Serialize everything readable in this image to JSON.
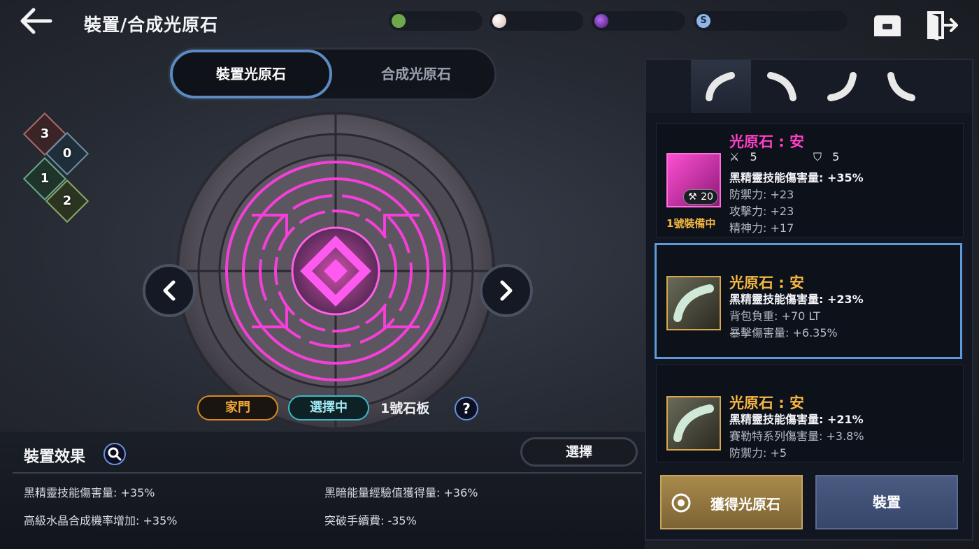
{
  "header": {
    "title": "裝置/合成光原石",
    "back_icon": "arrow-left-icon",
    "inventory_icon": "inventory-box-icon",
    "exit_icon": "exit-door-icon",
    "currencies": [
      {
        "icon": "green-crystal-icon",
        "color": "#6fa84a",
        "value": ""
      },
      {
        "icon": "pearl-icon",
        "color": "#e7c9c0",
        "value": ""
      },
      {
        "icon": "purple-orb-icon",
        "color": "#7a2fb8",
        "value": ""
      },
      {
        "icon": "silver-coin-icon",
        "color": "#8fb6e6",
        "value": ""
      }
    ]
  },
  "mode_tabs": {
    "equip": "裝置光原石",
    "synth": "合成光原石"
  },
  "badges": [
    "3",
    "0",
    "1",
    "2"
  ],
  "status": {
    "family": "家門",
    "selected": "選擇中",
    "slate": "1號石板",
    "help": "?"
  },
  "effects": {
    "title": "裝置效果",
    "select_label": "選擇",
    "items": [
      "黑精靈技能傷害量: +35%",
      "黑暗能量經驗值獲得量: +36%",
      "高級水晶合成機率增加: +35%",
      "突破手續費: -35%"
    ]
  },
  "slot_tabs": [
    "slot-arc-top-left-icon",
    "slot-arc-top-right-icon",
    "slot-arc-bottom-right-icon",
    "slot-arc-bottom-left-icon"
  ],
  "stones": [
    {
      "name": "光原石 : 安",
      "name_color": "#ff3fc8",
      "attack_stat": "5",
      "defense_stat": "5",
      "level": "20",
      "equipped_label": "1號裝備中",
      "main": "黑精靈技能傷害量: +35%",
      "lines": [
        "防禦力: +23",
        "攻擊力: +23",
        "精神力: +17"
      ]
    },
    {
      "name": "光原石 : 安",
      "name_color": "#f5b743",
      "main": "黑精靈技能傷害量: +23%",
      "lines": [
        "背包負重: +70 LT",
        "暴擊傷害量: +6.35%"
      ]
    },
    {
      "name": "光原石 : 安",
      "name_color": "#f5b743",
      "main": "黑精靈技能傷害量: +21%",
      "lines": [
        "賽勒特系列傷害量: +3.8%",
        "防禦力: +5"
      ]
    }
  ],
  "actions": {
    "obtain": "獲得光原石",
    "equip": "裝置"
  }
}
